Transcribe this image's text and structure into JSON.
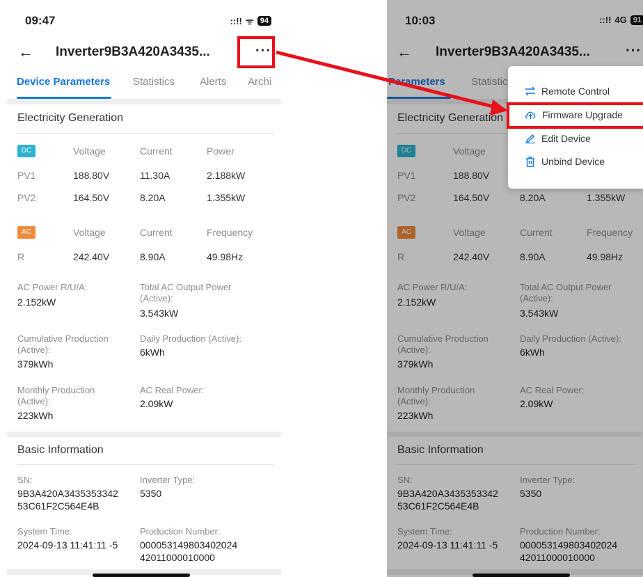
{
  "left_screen": {
    "status": {
      "time": "09:47",
      "signal": "::!!",
      "wifi": "ᯤ",
      "battery": "94"
    }
  },
  "right_screen": {
    "status": {
      "time": "10:03",
      "signal": "::!!",
      "network": "4G",
      "battery": "91"
    },
    "menu": {
      "items": [
        {
          "label": "Remote Control",
          "icon": "transfer-icon"
        },
        {
          "label": "Firmware Upgrade",
          "icon": "cloud-upload-icon"
        },
        {
          "label": "Edit Device",
          "icon": "pencil-icon"
        },
        {
          "label": "Unbind Device",
          "icon": "trash-icon"
        }
      ]
    }
  },
  "header": {
    "back": "←",
    "title": "Inverter9B3A420A3435...",
    "more": "···"
  },
  "tabs": [
    "Device Parameters",
    "Statistics",
    "Alerts",
    "Archi"
  ],
  "tabs_right": [
    "Parameters",
    "Statistic"
  ],
  "electricity": {
    "title": "Electricity Generation",
    "dc": {
      "tag": "DC",
      "headers": [
        "Voltage",
        "Current",
        "Power"
      ],
      "rows": [
        [
          "PV1",
          "188.80V",
          "11.30A",
          "2.188kW"
        ],
        [
          "PV2",
          "164.50V",
          "8.20A",
          "1.355kW"
        ]
      ]
    },
    "ac": {
      "tag": "AC",
      "headers": [
        "Voltage",
        "Current",
        "Frequency"
      ],
      "rows": [
        [
          "R",
          "242.40V",
          "8.90A",
          "49.98Hz"
        ]
      ]
    },
    "stats": [
      {
        "label": "AC Power R/U/A:",
        "value": "2.152kW"
      },
      {
        "label": "Total AC Output Power (Active):",
        "value": "3.543kW"
      },
      {
        "label": "Cumulative Production (Active):",
        "value": "379kWh"
      },
      {
        "label": "Daily Production (Active):",
        "value": "6kWh"
      },
      {
        "label": "Monthly Production (Active):",
        "value": "223kWh"
      },
      {
        "label": "AC Real Power:",
        "value": "2.09kW"
      }
    ]
  },
  "basic": {
    "title": "Basic Information",
    "sn_label": "SN:",
    "sn_line1": "9B3A420A3435353342",
    "sn_line2": "53C61F2C564E4B",
    "type_label": "Inverter Type:",
    "type_value": "5350",
    "time_label": "System Time:",
    "time_value": "2024-09-13 11:41:11 -5",
    "prod_label": "Production Number:",
    "prod_line1": "000053149803402024",
    "prod_line2": "42011000010000"
  },
  "colors": {
    "accent": "#1677d8",
    "dc_tag": "#2bb3cf",
    "ac_tag": "#f08b3d",
    "highlight": "#e8101a"
  }
}
